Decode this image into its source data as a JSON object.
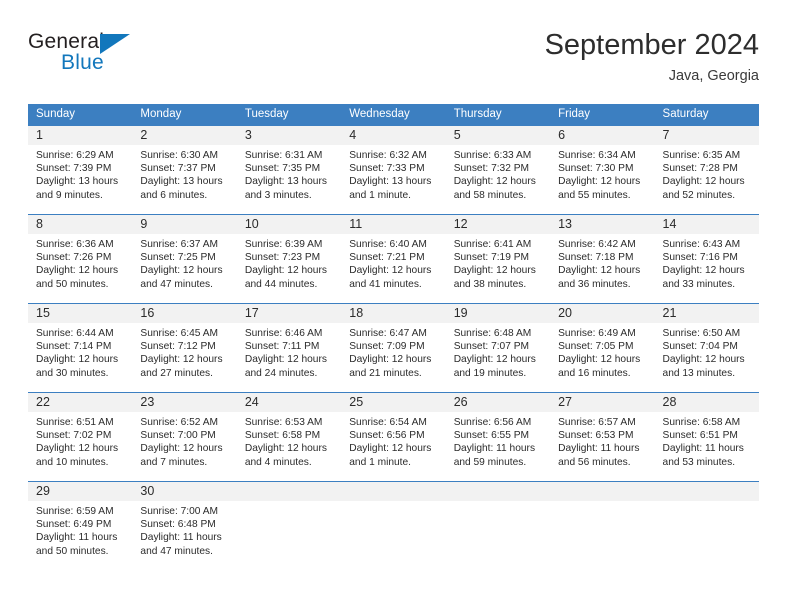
{
  "brand": {
    "name_top": "General",
    "name_bottom": "Blue",
    "triangle_color": "#1277bc",
    "text_color": "#231f20"
  },
  "header": {
    "title": "September 2024",
    "subtitle": "Java, Georgia"
  },
  "theme": {
    "header_blue": "#3c7fc1",
    "daynum_band": "#f2f2f2",
    "text": "#2b2b2b"
  },
  "weekdays": [
    "Sunday",
    "Monday",
    "Tuesday",
    "Wednesday",
    "Thursday",
    "Friday",
    "Saturday"
  ],
  "weeks": [
    {
      "days": [
        {
          "num": "1",
          "sunrise": "Sunrise: 6:29 AM",
          "sunset": "Sunset: 7:39 PM",
          "daylight_1": "Daylight: 13 hours",
          "daylight_2": "and 9 minutes."
        },
        {
          "num": "2",
          "sunrise": "Sunrise: 6:30 AM",
          "sunset": "Sunset: 7:37 PM",
          "daylight_1": "Daylight: 13 hours",
          "daylight_2": "and 6 minutes."
        },
        {
          "num": "3",
          "sunrise": "Sunrise: 6:31 AM",
          "sunset": "Sunset: 7:35 PM",
          "daylight_1": "Daylight: 13 hours",
          "daylight_2": "and 3 minutes."
        },
        {
          "num": "4",
          "sunrise": "Sunrise: 6:32 AM",
          "sunset": "Sunset: 7:33 PM",
          "daylight_1": "Daylight: 13 hours",
          "daylight_2": "and 1 minute."
        },
        {
          "num": "5",
          "sunrise": "Sunrise: 6:33 AM",
          "sunset": "Sunset: 7:32 PM",
          "daylight_1": "Daylight: 12 hours",
          "daylight_2": "and 58 minutes."
        },
        {
          "num": "6",
          "sunrise": "Sunrise: 6:34 AM",
          "sunset": "Sunset: 7:30 PM",
          "daylight_1": "Daylight: 12 hours",
          "daylight_2": "and 55 minutes."
        },
        {
          "num": "7",
          "sunrise": "Sunrise: 6:35 AM",
          "sunset": "Sunset: 7:28 PM",
          "daylight_1": "Daylight: 12 hours",
          "daylight_2": "and 52 minutes."
        }
      ]
    },
    {
      "days": [
        {
          "num": "8",
          "sunrise": "Sunrise: 6:36 AM",
          "sunset": "Sunset: 7:26 PM",
          "daylight_1": "Daylight: 12 hours",
          "daylight_2": "and 50 minutes."
        },
        {
          "num": "9",
          "sunrise": "Sunrise: 6:37 AM",
          "sunset": "Sunset: 7:25 PM",
          "daylight_1": "Daylight: 12 hours",
          "daylight_2": "and 47 minutes."
        },
        {
          "num": "10",
          "sunrise": "Sunrise: 6:39 AM",
          "sunset": "Sunset: 7:23 PM",
          "daylight_1": "Daylight: 12 hours",
          "daylight_2": "and 44 minutes."
        },
        {
          "num": "11",
          "sunrise": "Sunrise: 6:40 AM",
          "sunset": "Sunset: 7:21 PM",
          "daylight_1": "Daylight: 12 hours",
          "daylight_2": "and 41 minutes."
        },
        {
          "num": "12",
          "sunrise": "Sunrise: 6:41 AM",
          "sunset": "Sunset: 7:19 PM",
          "daylight_1": "Daylight: 12 hours",
          "daylight_2": "and 38 minutes."
        },
        {
          "num": "13",
          "sunrise": "Sunrise: 6:42 AM",
          "sunset": "Sunset: 7:18 PM",
          "daylight_1": "Daylight: 12 hours",
          "daylight_2": "and 36 minutes."
        },
        {
          "num": "14",
          "sunrise": "Sunrise: 6:43 AM",
          "sunset": "Sunset: 7:16 PM",
          "daylight_1": "Daylight: 12 hours",
          "daylight_2": "and 33 minutes."
        }
      ]
    },
    {
      "days": [
        {
          "num": "15",
          "sunrise": "Sunrise: 6:44 AM",
          "sunset": "Sunset: 7:14 PM",
          "daylight_1": "Daylight: 12 hours",
          "daylight_2": "and 30 minutes."
        },
        {
          "num": "16",
          "sunrise": "Sunrise: 6:45 AM",
          "sunset": "Sunset: 7:12 PM",
          "daylight_1": "Daylight: 12 hours",
          "daylight_2": "and 27 minutes."
        },
        {
          "num": "17",
          "sunrise": "Sunrise: 6:46 AM",
          "sunset": "Sunset: 7:11 PM",
          "daylight_1": "Daylight: 12 hours",
          "daylight_2": "and 24 minutes."
        },
        {
          "num": "18",
          "sunrise": "Sunrise: 6:47 AM",
          "sunset": "Sunset: 7:09 PM",
          "daylight_1": "Daylight: 12 hours",
          "daylight_2": "and 21 minutes."
        },
        {
          "num": "19",
          "sunrise": "Sunrise: 6:48 AM",
          "sunset": "Sunset: 7:07 PM",
          "daylight_1": "Daylight: 12 hours",
          "daylight_2": "and 19 minutes."
        },
        {
          "num": "20",
          "sunrise": "Sunrise: 6:49 AM",
          "sunset": "Sunset: 7:05 PM",
          "daylight_1": "Daylight: 12 hours",
          "daylight_2": "and 16 minutes."
        },
        {
          "num": "21",
          "sunrise": "Sunrise: 6:50 AM",
          "sunset": "Sunset: 7:04 PM",
          "daylight_1": "Daylight: 12 hours",
          "daylight_2": "and 13 minutes."
        }
      ]
    },
    {
      "days": [
        {
          "num": "22",
          "sunrise": "Sunrise: 6:51 AM",
          "sunset": "Sunset: 7:02 PM",
          "daylight_1": "Daylight: 12 hours",
          "daylight_2": "and 10 minutes."
        },
        {
          "num": "23",
          "sunrise": "Sunrise: 6:52 AM",
          "sunset": "Sunset: 7:00 PM",
          "daylight_1": "Daylight: 12 hours",
          "daylight_2": "and 7 minutes."
        },
        {
          "num": "24",
          "sunrise": "Sunrise: 6:53 AM",
          "sunset": "Sunset: 6:58 PM",
          "daylight_1": "Daylight: 12 hours",
          "daylight_2": "and 4 minutes."
        },
        {
          "num": "25",
          "sunrise": "Sunrise: 6:54 AM",
          "sunset": "Sunset: 6:56 PM",
          "daylight_1": "Daylight: 12 hours",
          "daylight_2": "and 1 minute."
        },
        {
          "num": "26",
          "sunrise": "Sunrise: 6:56 AM",
          "sunset": "Sunset: 6:55 PM",
          "daylight_1": "Daylight: 11 hours",
          "daylight_2": "and 59 minutes."
        },
        {
          "num": "27",
          "sunrise": "Sunrise: 6:57 AM",
          "sunset": "Sunset: 6:53 PM",
          "daylight_1": "Daylight: 11 hours",
          "daylight_2": "and 56 minutes."
        },
        {
          "num": "28",
          "sunrise": "Sunrise: 6:58 AM",
          "sunset": "Sunset: 6:51 PM",
          "daylight_1": "Daylight: 11 hours",
          "daylight_2": "and 53 minutes."
        }
      ]
    },
    {
      "days": [
        {
          "num": "29",
          "sunrise": "Sunrise: 6:59 AM",
          "sunset": "Sunset: 6:49 PM",
          "daylight_1": "Daylight: 11 hours",
          "daylight_2": "and 50 minutes."
        },
        {
          "num": "30",
          "sunrise": "Sunrise: 7:00 AM",
          "sunset": "Sunset: 6:48 PM",
          "daylight_1": "Daylight: 11 hours",
          "daylight_2": "and 47 minutes."
        },
        {
          "num": "",
          "sunrise": "",
          "sunset": "",
          "daylight_1": "",
          "daylight_2": ""
        },
        {
          "num": "",
          "sunrise": "",
          "sunset": "",
          "daylight_1": "",
          "daylight_2": ""
        },
        {
          "num": "",
          "sunrise": "",
          "sunset": "",
          "daylight_1": "",
          "daylight_2": ""
        },
        {
          "num": "",
          "sunrise": "",
          "sunset": "",
          "daylight_1": "",
          "daylight_2": ""
        },
        {
          "num": "",
          "sunrise": "",
          "sunset": "",
          "daylight_1": "",
          "daylight_2": ""
        }
      ]
    }
  ]
}
